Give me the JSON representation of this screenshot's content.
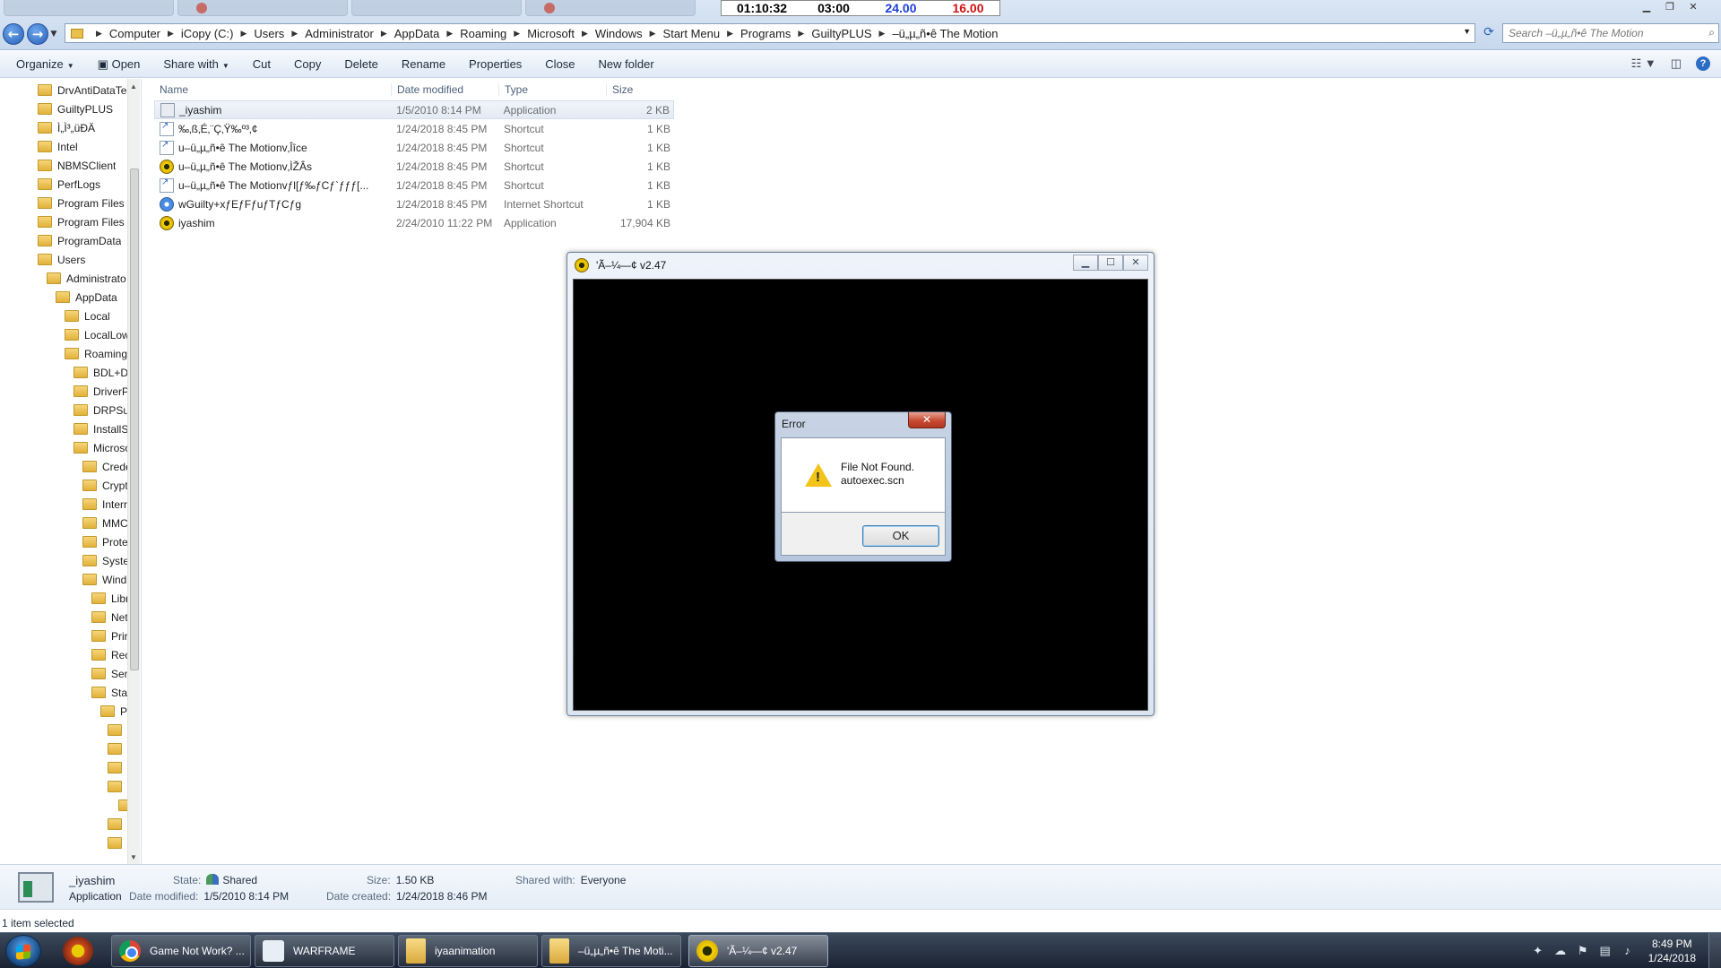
{
  "colors": {
    "accent": "#2b6cc4",
    "timer_blue": "#1d3fd6",
    "timer_red": "#d01010",
    "close_red": "#c74b32"
  },
  "timer": {
    "elapsed": "01:10:32",
    "clock": "03:00",
    "value_blue": "24.00",
    "value_red": "16.00"
  },
  "address": {
    "crumbs": [
      "Computer",
      "iCopy (C:)",
      "Users",
      "Administrator",
      "AppData",
      "Roaming",
      "Microsoft",
      "Windows",
      "Start Menu",
      "Programs",
      "GuiltyPLUS",
      "–ü„µ„ñ•ê The Motion"
    ],
    "search_placeholder": "Search –ü„µ„ñ•ê The Motion"
  },
  "toolbar": {
    "organize": "Organize",
    "share_with": "Share with",
    "open": "Open",
    "cut": "Cut",
    "copy": "Copy",
    "delete": "Delete",
    "rename": "Rename",
    "properties": "Properties",
    "close": "Close",
    "new_folder": "New folder"
  },
  "nav_tree": [
    "DrvAntiDataTer",
    "GuiltyPLUS",
    "Ì„Ì³„üÐÄ",
    "Intel",
    "NBMSClient",
    "PerfLogs",
    "Program Files",
    "Program Files (",
    "ProgramData",
    "Users",
    "Administrato",
    "AppData",
    "Local",
    "LocalLow",
    "Roaming",
    "BDL+D",
    "DriverP",
    "DRPSu",
    "InstallSl",
    "Microso",
    "Crede",
    "Crypt",
    "Interr",
    "MMC",
    "Prote",
    "Syster",
    "Wind",
    "Libr",
    "Net",
    "Prir",
    "Rec",
    "Sen",
    "Star",
    "Pr"
  ],
  "columns": {
    "name": "Name",
    "date": "Date modified",
    "type": "Type",
    "size": "Size"
  },
  "files": [
    {
      "name": "_iyashim",
      "date": "1/5/2010 8:14 PM",
      "type": "Application",
      "size": "2 KB",
      "icon": "app-icon"
    },
    {
      "name": "‰‚ß‚É‚¨Ç‚Ÿ‰º³‚¢",
      "date": "1/24/2018 8:45 PM",
      "type": "Shortcut",
      "size": "1 KB",
      "icon": "shortcut-icon"
    },
    {
      "name": "u–ü„µ„ñ•ê The Motionv‚Îîce",
      "date": "1/24/2018 8:45 PM",
      "type": "Shortcut",
      "size": "1 KB",
      "icon": "shortcut-icon"
    },
    {
      "name": "u–ü„µ„ñ•ê The Motionv‚ÌŽÂs",
      "date": "1/24/2018 8:45 PM",
      "type": "Shortcut",
      "size": "1 KB",
      "icon": "sun-shortcut-icon"
    },
    {
      "name": "u–ü„µ„ñ•ê The Motionvƒl[ƒ‰ƒCƒ`ƒƒƒ[...",
      "date": "1/24/2018 8:45 PM",
      "type": "Shortcut",
      "size": "1 KB",
      "icon": "shortcut-icon"
    },
    {
      "name": "wGuilty+xƒEƒFƒuƒTƒCƒg",
      "date": "1/24/2018 8:45 PM",
      "type": "Internet Shortcut",
      "size": "1 KB",
      "icon": "web-shortcut-icon"
    },
    {
      "name": "iyashim",
      "date": "2/24/2010 11:22 PM",
      "type": "Application",
      "size": "17,904 KB",
      "icon": "sun-app-icon"
    }
  ],
  "game_window": {
    "title": "'Ã–¼—¢ v2.47"
  },
  "error_dialog": {
    "title": "Error",
    "line1": "File Not Found.",
    "line2": "autoexec.scn",
    "ok": "OK"
  },
  "details": {
    "name": "_iyashim",
    "kind": "Application",
    "state_label": "State:",
    "state": "Shared",
    "size_label": "Size:",
    "size": "1.50 KB",
    "shared_label": "Shared with:",
    "shared": "Everyone",
    "modified_label": "Date modified:",
    "modified": "1/5/2010 8:14 PM",
    "created_label": "Date created:",
    "created": "1/24/2018 8:46 PM"
  },
  "status": "1 item selected",
  "taskbar": {
    "tasks": [
      "Game Not Work? ...",
      "WARFRAME",
      "iyaanimation",
      "–ü„µ„ñ•ê The Moti...",
      "'Ã–¼—¢ v2.47"
    ],
    "time": "8:49 PM",
    "date": "1/24/2018"
  }
}
